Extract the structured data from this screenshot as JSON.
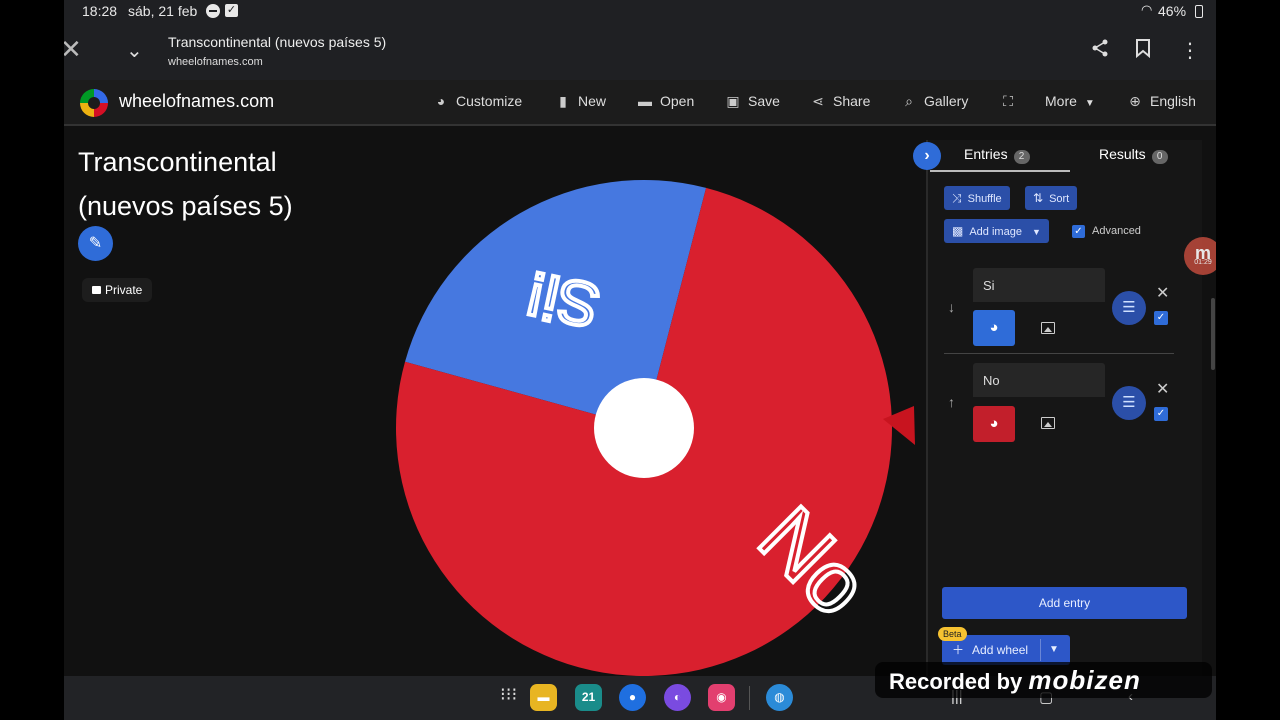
{
  "status_bar": {
    "time": "18:28",
    "date": "sáb, 21 feb",
    "battery": "46%"
  },
  "browser": {
    "page_title": "Transcontinental (nuevos países 5)",
    "url": "wheelofnames.com"
  },
  "header": {
    "site_name": "wheelofnames.com",
    "nav": {
      "customize": "Customize",
      "new": "New",
      "open": "Open",
      "save": "Save",
      "share": "Share",
      "gallery": "Gallery",
      "more": "More",
      "language": "English"
    }
  },
  "wheel": {
    "title": "Transcontinental (nuevos países 5)",
    "visibility": "Private",
    "segments": [
      {
        "label": "Si",
        "color": "#4678e0"
      },
      {
        "label": "No",
        "color": "#d9202e"
      }
    ]
  },
  "panel": {
    "tabs": {
      "entries_label": "Entries",
      "entries_count": "2",
      "results_label": "Results",
      "results_count": "0"
    },
    "shuffle": "Shuffle",
    "sort": "Sort",
    "add_image": "Add image",
    "advanced": "Advanced",
    "entries": [
      {
        "text": "Si",
        "color": "#2f6cd8"
      },
      {
        "text": "No",
        "color": "#c21f2b"
      }
    ],
    "add_entry": "Add entry",
    "add_wheel": "Add wheel",
    "beta": "Beta"
  },
  "overlays": {
    "recorder_time": "01:29",
    "watermark_prefix": "Recorded by",
    "watermark_brand": "mobizen"
  },
  "colors": {
    "accent": "#2f6cd8",
    "wheel_red": "#d9202e",
    "wheel_blue": "#4678e0"
  }
}
